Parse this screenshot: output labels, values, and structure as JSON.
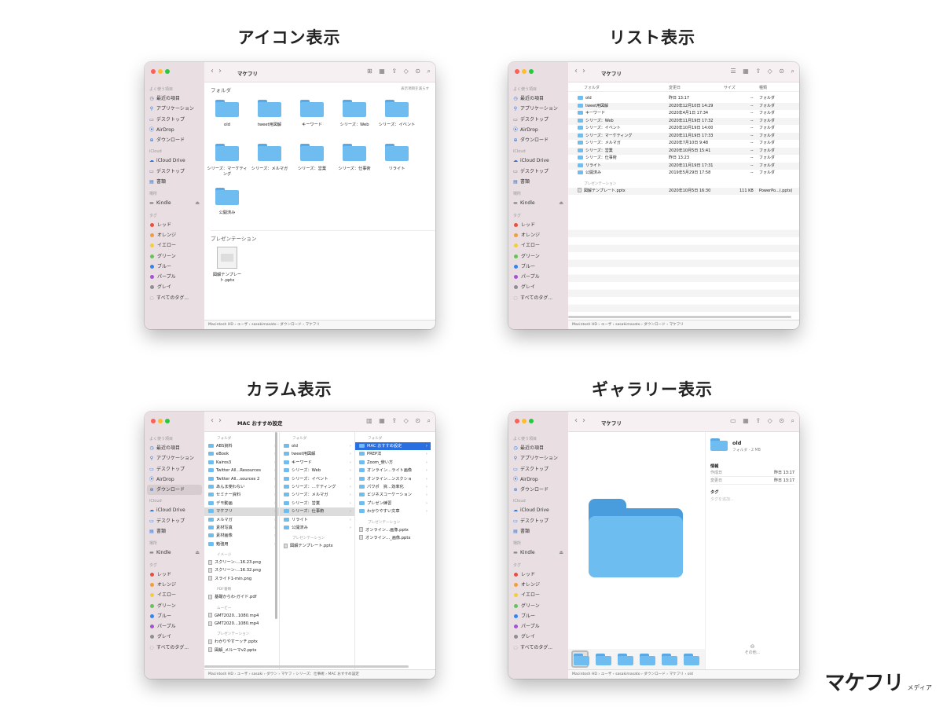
{
  "titles": {
    "icon": "アイコン表示",
    "list": "リスト表示",
    "column": "カラム表示",
    "gallery": "ギャラリー表示"
  },
  "sidebar": {
    "sections": {
      "fav": "よく使う項目",
      "icloud": "iCloud",
      "places": "場所",
      "tags": "タグ"
    },
    "fav": [
      "最近の項目",
      "アプリケーション",
      "デスクトップ",
      "AirDrop",
      "ダウンロード"
    ],
    "icloud": [
      "iCloud Drive",
      "デスクトップ",
      "書類"
    ],
    "places": [
      "Kindle"
    ],
    "tags": [
      {
        "label": "レッド",
        "color": "#ea4e3d"
      },
      {
        "label": "オレンジ",
        "color": "#f29d38"
      },
      {
        "label": "イエロー",
        "color": "#f3cd3a"
      },
      {
        "label": "グリーン",
        "color": "#62c554"
      },
      {
        "label": "ブルー",
        "color": "#2f86f3"
      },
      {
        "label": "パープル",
        "color": "#a453d2"
      },
      {
        "label": "グレイ",
        "color": "#8e8e93"
      }
    ],
    "all_tags": "すべてのタグ..."
  },
  "icon_view": {
    "toolbar_title": "マケフリ",
    "section_folder": "フォルダ",
    "show_all": "表示項目を減らす",
    "folders": [
      "old",
      "tweet用図解",
      "キーワード",
      "シリーズ：Web",
      "シリーズ：イベント",
      "シリーズ：マーケティング",
      "シリーズ：メルマガ",
      "シリーズ：営業",
      "シリーズ：仕事術",
      "リライト",
      "公開済み"
    ],
    "section_pres": "プレゼンテーション",
    "pres_file": "図解テンプレート.pptx",
    "path": "Macintosh HD › ユーザ › sasakimasato › ダウンロード › マケフリ"
  },
  "list_view": {
    "toolbar_title": "マケフリ",
    "headers": [
      "フォルダ",
      "変更日",
      "サイズ",
      "種類"
    ],
    "rows": [
      {
        "name": "old",
        "date": "昨日 13:17",
        "size": "--",
        "kind": "フォルダ"
      },
      {
        "name": "tweet用図解",
        "date": "2020年12月10日 14:29",
        "size": "--",
        "kind": "フォルダ"
      },
      {
        "name": "キーワード",
        "date": "2020年4月1日 17:34",
        "size": "--",
        "kind": "フォルダ"
      },
      {
        "name": "シリーズ：Web",
        "date": "2020年11月19日 17:32",
        "size": "--",
        "kind": "フォルダ"
      },
      {
        "name": "シリーズ：イベント",
        "date": "2020年10月19日 14:00",
        "size": "--",
        "kind": "フォルダ"
      },
      {
        "name": "シリーズ：マーケティング",
        "date": "2020年11月19日 17:33",
        "size": "--",
        "kind": "フォルダ"
      },
      {
        "name": "シリーズ：メルマガ",
        "date": "2020年7月10日 9:48",
        "size": "--",
        "kind": "フォルダ"
      },
      {
        "name": "シリーズ：営業",
        "date": "2020年10月5日 15:41",
        "size": "--",
        "kind": "フォルダ"
      },
      {
        "name": "シリーズ：仕事術",
        "date": "昨日 13:23",
        "size": "--",
        "kind": "フォルダ"
      },
      {
        "name": "リライト",
        "date": "2020年11月19日 17:31",
        "size": "--",
        "kind": "フォルダ"
      },
      {
        "name": "公開済み",
        "date": "2019年5月29日 17:58",
        "size": "--",
        "kind": "フォルダ"
      }
    ],
    "section_pres": "プレゼンテーション",
    "pres_row": {
      "name": "図解テンプレート.pptx",
      "date": "2020年10月5日 16:30",
      "size": "111 KB",
      "kind": "PowerPo...(.pptx)"
    },
    "path": "Macintosh HD › ユーザ › sasakimasato › ダウンロード › マケフリ"
  },
  "column_view": {
    "toolbar_title": "MAC おすすめ設定",
    "col1_head": "フォルダ",
    "col1": [
      "ABS資料",
      "eBook",
      "Kairos3",
      "Twitter All...Resources",
      "Twitter All...sources 2",
      "あんま使わない",
      "セミナー資料",
      "デモ動画",
      "マケフリ",
      "メルマガ",
      "素材写真",
      "素材画像",
      "勉強用"
    ],
    "col1_img_head": "イメージ",
    "col1_img": [
      "スクリーン-...16.23.png",
      "スクリーン-...16.32.png",
      "スライド1-min.png"
    ],
    "col1_pdf_head": "PDF書類",
    "col1_pdf": [
      "基礎からわ-ガイド.pdf"
    ],
    "col1_mov_head": "ムービー",
    "col1_mov": [
      "GMT2020...1080.mp4",
      "GMT2020...1080.mp4"
    ],
    "col1_pres_head": "プレゼンテーション",
    "col1_pres": [
      "わかりやすーッチ.pptx",
      "図解_メルーマv2.pptx"
    ],
    "col2_head": "フォルダ",
    "col2": [
      "old",
      "tweet用図解",
      "キーワード",
      "シリーズ：Web",
      "シリーズ：イベント",
      "シリーズ：…ケティング",
      "シリーズ：メルマガ",
      "シリーズ：営業",
      "シリーズ：仕事術",
      "リライト",
      "公開済み"
    ],
    "col2_pres_head": "プレゼンテーション",
    "col2_pres": [
      "図解テンプレート.pptx"
    ],
    "col3_head": "フォルダ",
    "col3": [
      "MAC おすすめ設定",
      "PREP法",
      "Zoom_使い方",
      "オンライン…ライト画像",
      "オンライン…ンスクショ",
      "パワポ　資…効率化",
      "ビジネスコーケーション",
      "プレゼン練習",
      "わかりやすい文章"
    ],
    "col3_pres_head": "プレゼンテーション",
    "col3_pres": [
      "オンライン…画像.pptx",
      "オンライン…_画像.pptx"
    ],
    "path": "Macintosh HD › ユーザ › sasaki › ダウン › マケフ › シリーズ：仕事術 › MAC おすすめ設定"
  },
  "gallery_view": {
    "toolbar_title": "マケフリ",
    "info_name": "old",
    "info_sub": "フォルダ - 2 MB",
    "info_head": "情報",
    "created_label": "作成日",
    "created_val": "昨日 13:17",
    "modified_label": "変更日",
    "modified_val": "昨日 13:17",
    "tag_head": "タグ",
    "tag_placeholder": "タグを追加...",
    "more": "その他...",
    "path": "Macintosh HD › ユーザ › sasakimasato › ダウンロード › マケフリ › old"
  },
  "logo": {
    "main": "マケフリ",
    "sub": "メディア"
  }
}
